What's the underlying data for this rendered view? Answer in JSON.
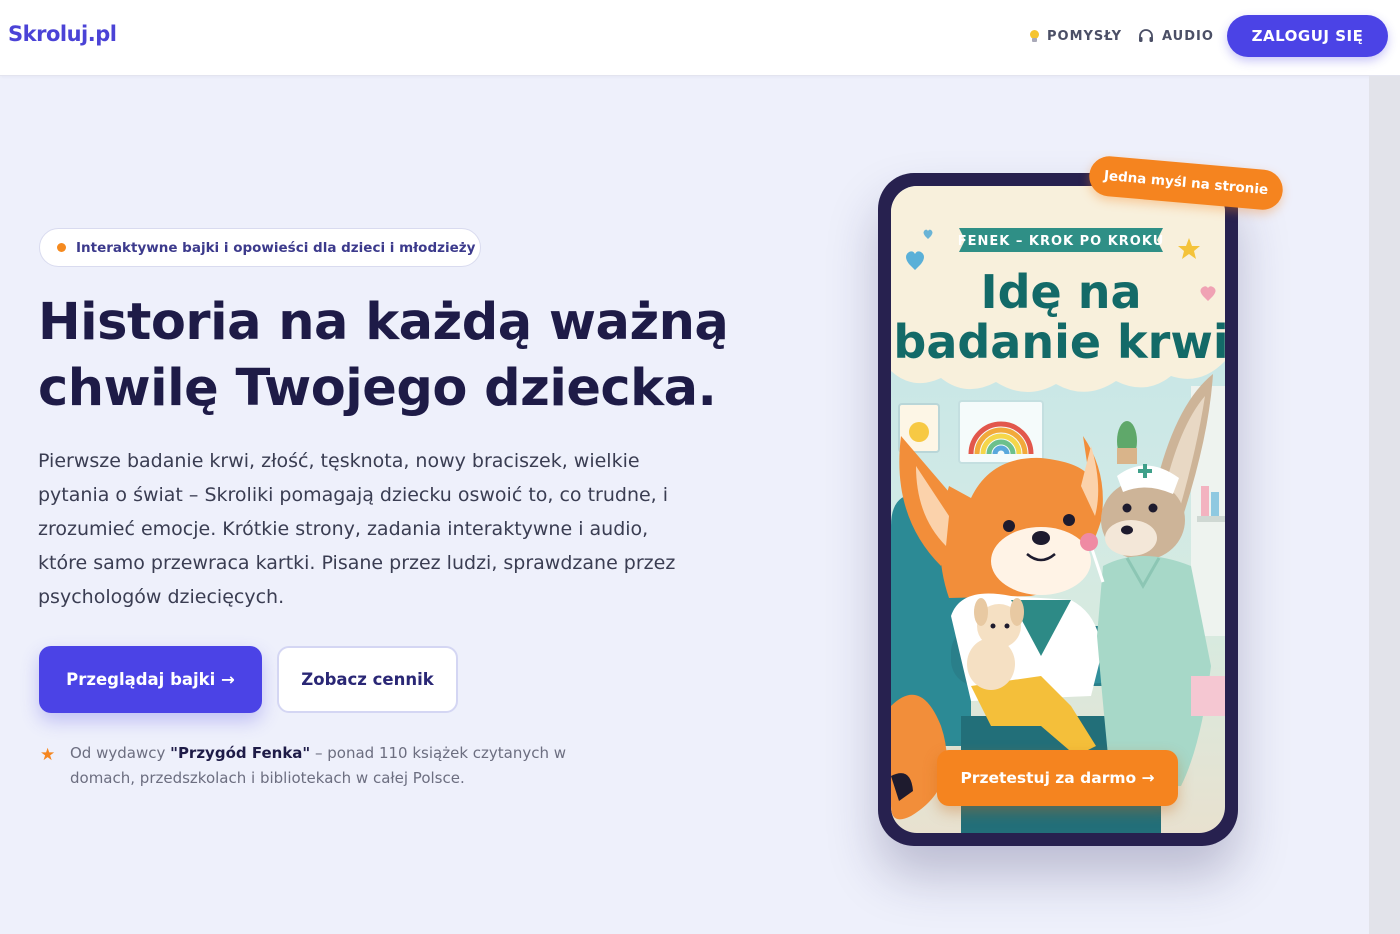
{
  "header": {
    "logo": "Skroluj.pl",
    "nav": [
      {
        "label": "POMYSŁY",
        "icon": "lightbulb-icon"
      },
      {
        "label": "AUDIO",
        "icon": "headphones-icon"
      }
    ],
    "login_label": "ZALOGUJ SIĘ"
  },
  "hero": {
    "badge": "Interaktywne bajki i opowieści dla dzieci i młodzieży",
    "title_line1": "Historia na każdą ważną",
    "title_line2": "chwilę Twojego dziecka.",
    "description": "Pierwsze badanie krwi, złość, tęsknota, nowy braciszek, wielkie pytania o świat – Skroliki pomagają dziecku oswoić to, co trudne, i zrozumieć emocje. Krótkie strony, zadania interaktywne i audio, które samo przewraca kartki. Pisane przez ludzi, sprawdzane przez psychologów dziecięcych.",
    "primary_button": "Przeglądaj bajki →",
    "secondary_button": "Zobacz cennik",
    "publisher_prefix": "Od wydawcy ",
    "publisher_name": "\"Przygód Fenka\"",
    "publisher_suffix": " – ponad 110 książek czytanych w domach, przedszkolach i bibliotekach w całej Polsce."
  },
  "phone": {
    "sticker": "Jedna myśl na stronie",
    "series": "FENEK – KROK PO KROKU",
    "title_line1": "Idę na",
    "title_line2": "badanie krwi",
    "cta": "Przetestuj za darmo →"
  },
  "colors": {
    "accent": "#4b43e6",
    "orange": "#f5841f",
    "title": "#1e1b47",
    "background": "#eef0fb"
  }
}
